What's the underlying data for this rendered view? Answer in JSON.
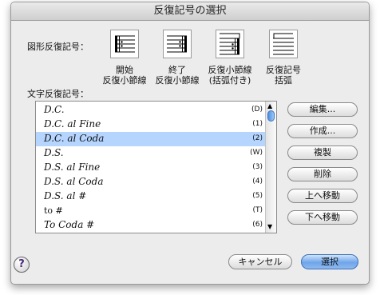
{
  "dialog": {
    "title": "反復記号の選択",
    "graphic_label": "図形反復記号：",
    "text_label": "文字反復記号：",
    "graphic_symbols": [
      {
        "caption": "開始\n反復小節線"
      },
      {
        "caption": "終了\n反復小節線"
      },
      {
        "caption": "反復小節線\n(括弧付き)"
      },
      {
        "caption": "反復記号\n括弧"
      }
    ],
    "text_symbols": [
      {
        "name": "D.C.",
        "key": "(D)",
        "selected": false,
        "italic": true
      },
      {
        "name": "D.C. al Fine",
        "key": "(1)",
        "selected": false,
        "italic": true
      },
      {
        "name": "D.C. al Coda",
        "key": "(2)",
        "selected": true,
        "italic": true
      },
      {
        "name": "D.S.",
        "key": "(W)",
        "selected": false,
        "italic": true
      },
      {
        "name": "D.S. al Fine",
        "key": "(3)",
        "selected": false,
        "italic": true
      },
      {
        "name": "D.S. al Coda",
        "key": "(4)",
        "selected": false,
        "italic": true
      },
      {
        "name": "D.S. al #",
        "key": "(5)",
        "selected": false,
        "italic": true
      },
      {
        "name": "to #",
        "key": "(T)",
        "selected": false,
        "italic": false
      },
      {
        "name": "To Coda #",
        "key": "(6)",
        "selected": false,
        "italic": true
      }
    ],
    "side_buttons": {
      "edit": "編集...",
      "create": "作成...",
      "duplicate": "複製",
      "delete": "削除",
      "move_up": "上へ移動",
      "move_down": "下へ移動"
    },
    "help": "?",
    "cancel": "キャンセル",
    "ok": "選択",
    "scroll_up": "▲",
    "scroll_down": "▼",
    "colors": {
      "selection": "#b5d5ff",
      "default_button": "#6fa5ea"
    }
  }
}
